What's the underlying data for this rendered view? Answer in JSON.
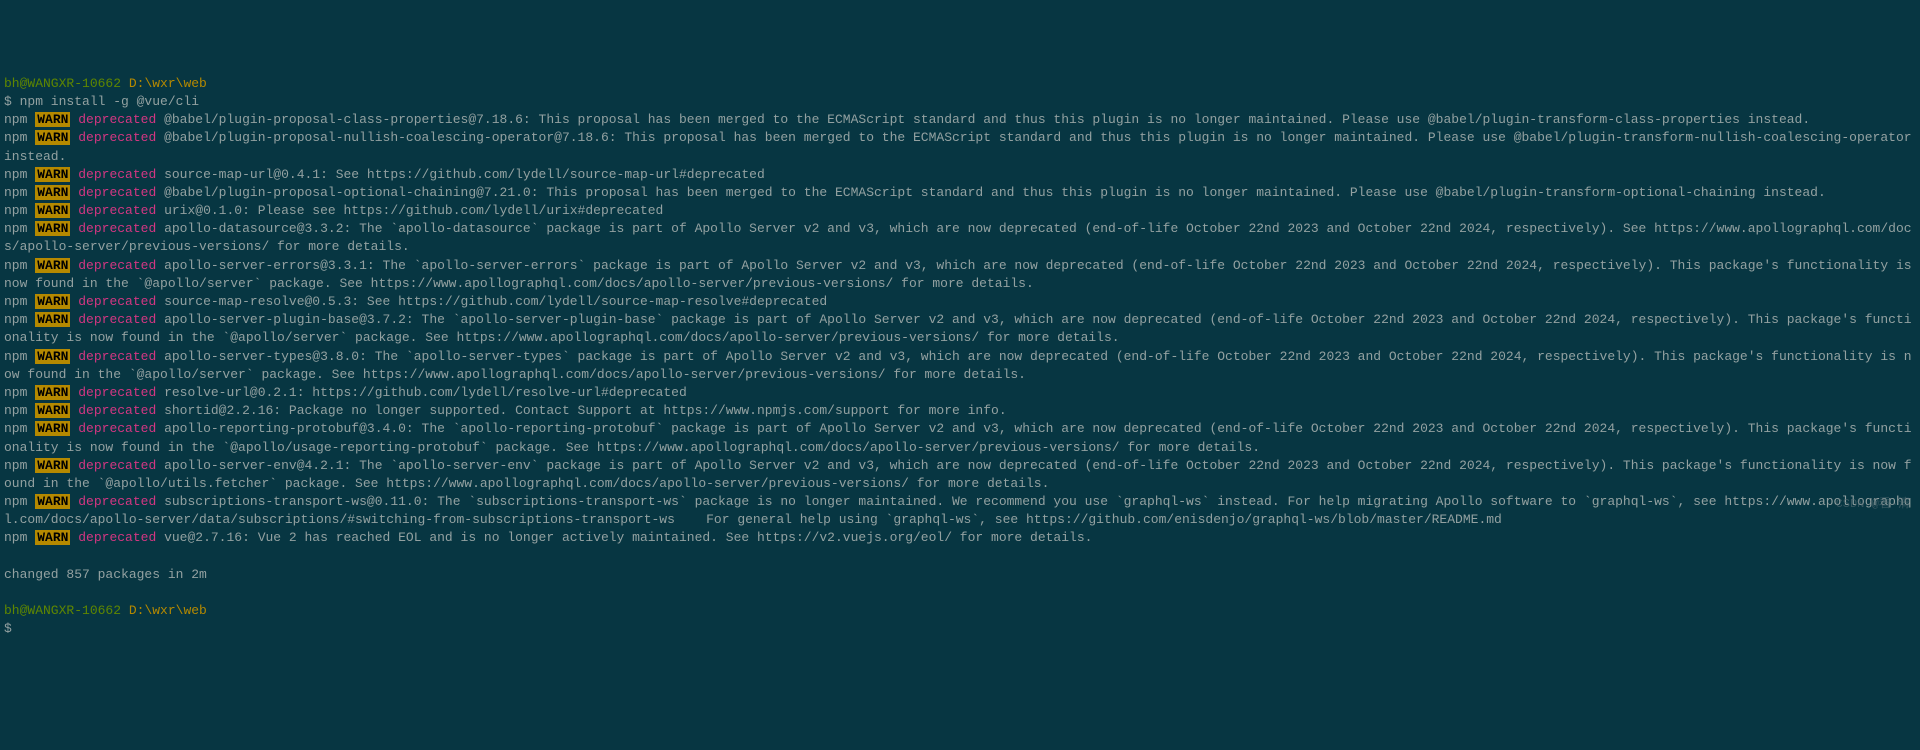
{
  "prompt": {
    "user_host": "bh@WANGXR-10662",
    "path": "D:\\wxr\\web"
  },
  "command": "$ npm install -g @vue/cli",
  "warnings": [
    {
      "pkg": "@babel/plugin-proposal-class-properties@7.18.6",
      "msg": "This proposal has been merged to the ECMAScript standard and thus this plugin is no longer maintained. Please use @babel/plugin-transform-class-properties instead."
    },
    {
      "pkg": "@babel/plugin-proposal-nullish-coalescing-operator@7.18.6",
      "msg": "This proposal has been merged to the ECMAScript standard and thus this plugin is no longer maintained. Please use @babel/plugin-transform-nullish-coalescing-operator instead."
    },
    {
      "pkg": "source-map-url@0.4.1",
      "msg": "See https://github.com/lydell/source-map-url#deprecated"
    },
    {
      "pkg": "@babel/plugin-proposal-optional-chaining@7.21.0",
      "msg": "This proposal has been merged to the ECMAScript standard and thus this plugin is no longer maintained. Please use @babel/plugin-transform-optional-chaining instead."
    },
    {
      "pkg": "urix@0.1.0",
      "msg": "Please see https://github.com/lydell/urix#deprecated"
    },
    {
      "pkg": "apollo-datasource@3.3.2",
      "msg": "The `apollo-datasource` package is part of Apollo Server v2 and v3, which are now deprecated (end-of-life October 22nd 2023 and October 22nd 2024, respectively). See https://www.apollographql.com/docs/apollo-server/previous-versions/ for more details."
    },
    {
      "pkg": "apollo-server-errors@3.3.1",
      "msg": "The `apollo-server-errors` package is part of Apollo Server v2 and v3, which are now deprecated (end-of-life October 22nd 2023 and October 22nd 2024, respectively). This package's functionality is now found in the `@apollo/server` package. See https://www.apollographql.com/docs/apollo-server/previous-versions/ for more details."
    },
    {
      "pkg": "source-map-resolve@0.5.3",
      "msg": "See https://github.com/lydell/source-map-resolve#deprecated"
    },
    {
      "pkg": "apollo-server-plugin-base@3.7.2",
      "msg": "The `apollo-server-plugin-base` package is part of Apollo Server v2 and v3, which are now deprecated (end-of-life October 22nd 2023 and October 22nd 2024, respectively). This package's functionality is now found in the `@apollo/server` package. See https://www.apollographql.com/docs/apollo-server/previous-versions/ for more details."
    },
    {
      "pkg": "apollo-server-types@3.8.0",
      "msg": "The `apollo-server-types` package is part of Apollo Server v2 and v3, which are now deprecated (end-of-life October 22nd 2023 and October 22nd 2024, respectively). This package's functionality is now found in the `@apollo/server` package. See https://www.apollographql.com/docs/apollo-server/previous-versions/ for more details."
    },
    {
      "pkg": "resolve-url@0.2.1",
      "msg": "https://github.com/lydell/resolve-url#deprecated"
    },
    {
      "pkg": "shortid@2.2.16",
      "msg": "Package no longer supported. Contact Support at https://www.npmjs.com/support for more info."
    },
    {
      "pkg": "apollo-reporting-protobuf@3.4.0",
      "msg": "The `apollo-reporting-protobuf` package is part of Apollo Server v2 and v3, which are now deprecated (end-of-life October 22nd 2023 and October 22nd 2024, respectively). This package's functionality is now found in the `@apollo/usage-reporting-protobuf` package. See https://www.apollographql.com/docs/apollo-server/previous-versions/ for more details."
    },
    {
      "pkg": "apollo-server-env@4.2.1",
      "msg": "The `apollo-server-env` package is part of Apollo Server v2 and v3, which are now deprecated (end-of-life October 22nd 2023 and October 22nd 2024, respectively). This package's functionality is now found in the `@apollo/utils.fetcher` package. See https://www.apollographql.com/docs/apollo-server/previous-versions/ for more details."
    },
    {
      "pkg": "subscriptions-transport-ws@0.11.0",
      "msg": "The `subscriptions-transport-ws` package is no longer maintained. We recommend you use `graphql-ws` instead. For help migrating Apollo software to `graphql-ws`, see https://www.apollographql.com/docs/apollo-server/data/subscriptions/#switching-from-subscriptions-transport-ws    For general help using `graphql-ws`, see https://github.com/enisdenjo/graphql-ws/blob/master/README.md"
    },
    {
      "pkg": "vue@2.7.16",
      "msg": "Vue 2 has reached EOL and is no longer actively maintained. See https://v2.vuejs.org/eol/ for more details."
    }
  ],
  "labels": {
    "npm": "npm",
    "warn": "WARN",
    "deprecated": "deprecated"
  },
  "result": "changed 857 packages in 2m",
  "watermark": "CSDN @看-清",
  "cursor": "$"
}
